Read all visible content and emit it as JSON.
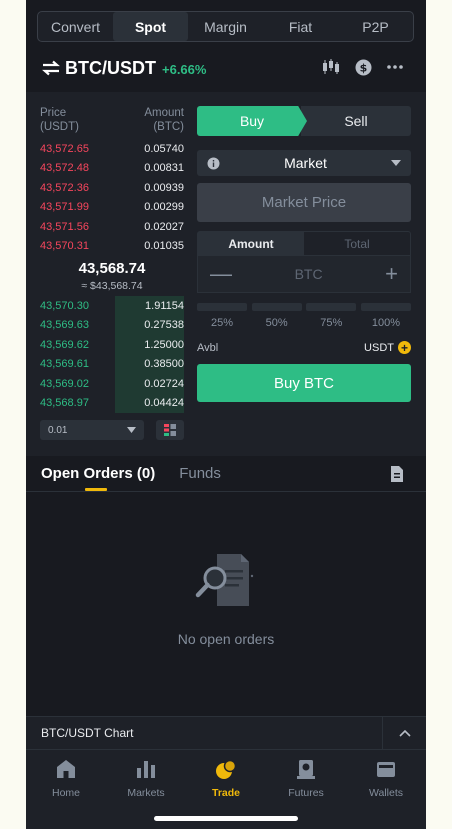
{
  "mode_tabs": [
    "Convert",
    "Spot",
    "Margin",
    "Fiat",
    "P2P"
  ],
  "pair": {
    "name": "BTC/USDT",
    "change": "+6.66%"
  },
  "orderbook": {
    "price_header": [
      "Price",
      "(USDT)"
    ],
    "amount_header": [
      "Amount",
      "(BTC)"
    ],
    "asks": [
      {
        "price": "43,572.65",
        "amount": "0.05740"
      },
      {
        "price": "43,572.48",
        "amount": "0.00831"
      },
      {
        "price": "43,572.36",
        "amount": "0.00939"
      },
      {
        "price": "43,571.99",
        "amount": "0.00299"
      },
      {
        "price": "43,571.56",
        "amount": "0.02027"
      },
      {
        "price": "43,570.31",
        "amount": "0.01035"
      }
    ],
    "mid_price": "43,568.74",
    "mid_usd": "≈ $43,568.74",
    "bids": [
      {
        "price": "43,570.30",
        "amount": "1.91154",
        "depth": 0.48
      },
      {
        "price": "43,569.63",
        "amount": "0.27538",
        "depth": 0.48
      },
      {
        "price": "43,569.62",
        "amount": "1.25000",
        "depth": 0.48
      },
      {
        "price": "43,569.61",
        "amount": "0.38500",
        "depth": 0.48
      },
      {
        "price": "43,569.02",
        "amount": "0.02724",
        "depth": 0.48
      },
      {
        "price": "43,568.97",
        "amount": "0.04424",
        "depth": 0.48
      }
    ],
    "precision": "0.01"
  },
  "form": {
    "buy_label": "Buy",
    "sell_label": "Sell",
    "order_type": "Market",
    "price_placeholder": "Market Price",
    "amount_tab": "Amount",
    "total_tab": "Total",
    "qty_unit": "BTC",
    "percents": [
      "25%",
      "50%",
      "75%",
      "100%"
    ],
    "avbl_label": "Avbl",
    "avbl_currency": "USDT",
    "submit_label": "Buy BTC"
  },
  "orders": {
    "open_orders_tab": "Open Orders (0)",
    "funds_tab": "Funds",
    "empty_text": "No open orders"
  },
  "chart_bar": {
    "label": "BTC/USDT Chart"
  },
  "nav": [
    {
      "label": "Home",
      "icon": "home-icon"
    },
    {
      "label": "Markets",
      "icon": "markets-icon"
    },
    {
      "label": "Trade",
      "icon": "trade-icon",
      "active": true
    },
    {
      "label": "Futures",
      "icon": "futures-icon"
    },
    {
      "label": "Wallets",
      "icon": "wallets-icon"
    }
  ],
  "colors": {
    "accent": "#f0b90b",
    "buy": "#2ebd85",
    "sell": "#f6465d",
    "bg": "#181a20"
  }
}
